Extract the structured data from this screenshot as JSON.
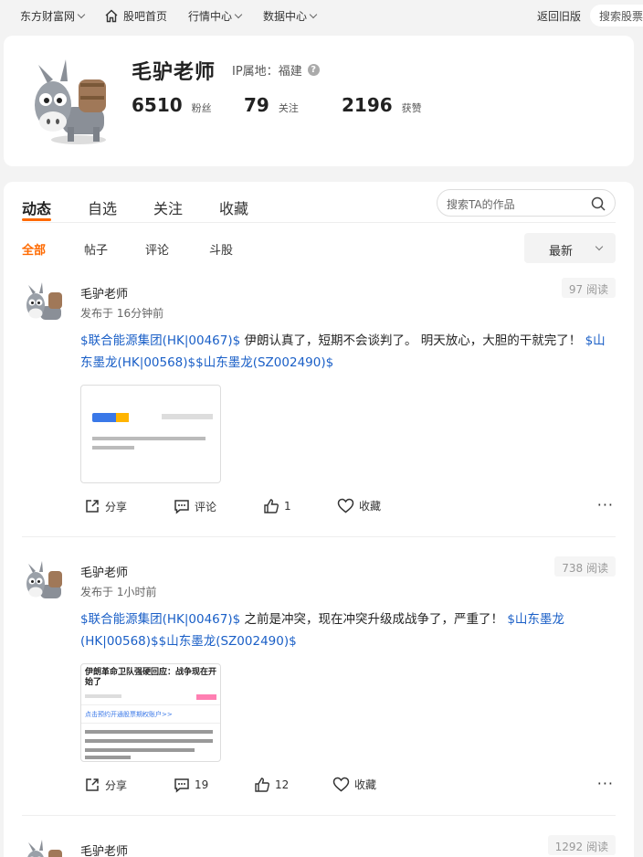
{
  "topnav": {
    "brand": "东方财富网",
    "home": "股吧首页",
    "market": "行情中心",
    "data": "数据中心",
    "old_version": "返回旧版",
    "search_placeholder": "搜索股票"
  },
  "profile": {
    "name": "毛驴老师",
    "ip_label": "IP属地：",
    "ip_value": "福建",
    "fans_count": "6510",
    "fans_label": "粉丝",
    "follow_count": "79",
    "follow_label": "关注",
    "likes_count": "2196",
    "likes_label": "获赞"
  },
  "tabs": [
    "动态",
    "自选",
    "关注",
    "收藏"
  ],
  "search_ta_placeholder": "搜索TA的作品",
  "subtabs": [
    "全部",
    "帖子",
    "评论",
    "斗股"
  ],
  "sort": "最新",
  "posts": [
    {
      "author": "毛驴老师",
      "time": "发布于 16分钟前",
      "reads": "97 阅读",
      "stock_a": "$联合能源集团(HK|00467)$",
      "text_a": " 伊朗认真了，短期不会谈判了。 明天放心，大胆的干就完了！ ",
      "stock_b": "$山东墨龙(HK|00568)$",
      "stock_c": "$山东墨龙(SZ002490)$",
      "share": "分享",
      "comment": "评论",
      "likes": "1",
      "favorite": "收藏"
    },
    {
      "author": "毛驴老师",
      "time": "发布于 1小时前",
      "reads": "738 阅读",
      "stock_a": "$联合能源集团(HK|00467)$",
      "text_a": " 之前是冲突，现在冲突升级成战争了，严重了！ ",
      "stock_b": "$山东墨龙(HK|00568)$",
      "stock_c": "$山东墨龙(SZ002490)$",
      "share": "分享",
      "comment": "19",
      "likes": "12",
      "favorite": "收藏",
      "thumb_title": "伊朗革命卫队强硬回应：战争现在开始了",
      "thumb_link": "点击预约开通股票期权账户>>"
    },
    {
      "author": "毛驴老师",
      "reads": "1292 阅读"
    }
  ],
  "colors": {
    "accent": "#ff6a00",
    "stock_link": "#1a5fc7"
  }
}
